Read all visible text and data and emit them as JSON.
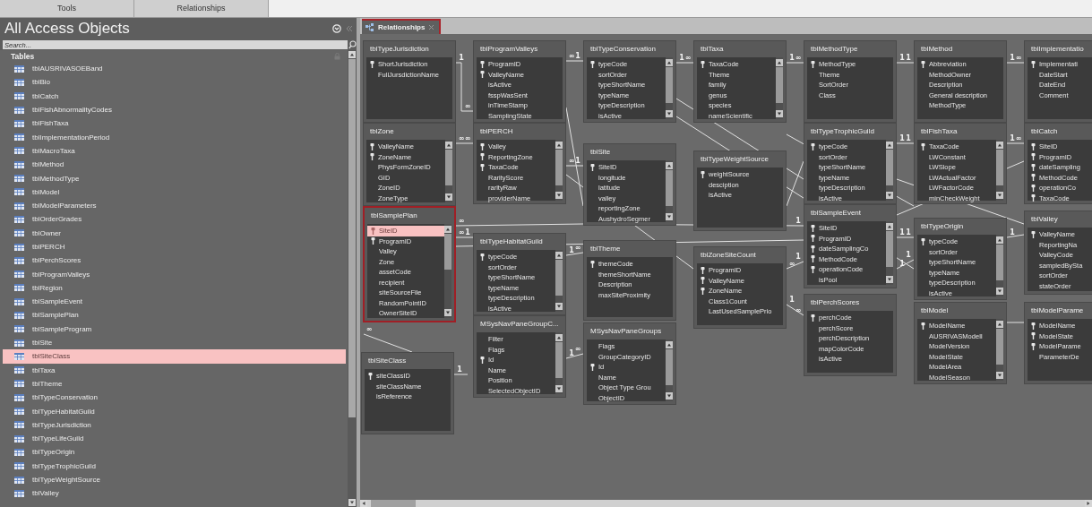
{
  "ribbon_groups": [
    "Tools",
    "Relationships"
  ],
  "navigation_pane": {
    "title": "All Access Objects",
    "search": {
      "placeholder": "Search..."
    },
    "group": "Tables",
    "items": [
      {
        "label": "tblAUSRIVASOEBand",
        "selected": false
      },
      {
        "label": "tblBio",
        "selected": false
      },
      {
        "label": "tblCatch",
        "selected": false
      },
      {
        "label": "tblFishAbnormalityCodes",
        "selected": false
      },
      {
        "label": "tblFishTaxa",
        "selected": false
      },
      {
        "label": "tblImplementationPeriod",
        "selected": false
      },
      {
        "label": "tblMacroTaxa",
        "selected": false
      },
      {
        "label": "tblMethod",
        "selected": false
      },
      {
        "label": "tblMethodType",
        "selected": false
      },
      {
        "label": "tblModel",
        "selected": false
      },
      {
        "label": "tblModelParameters",
        "selected": false
      },
      {
        "label": "tblOrderGrades",
        "selected": false
      },
      {
        "label": "tblOwner",
        "selected": false
      },
      {
        "label": "tblPERCH",
        "selected": false
      },
      {
        "label": "tblPerchScores",
        "selected": false
      },
      {
        "label": "tblProgramValleys",
        "selected": false
      },
      {
        "label": "tblRegion",
        "selected": false
      },
      {
        "label": "tblSampleEvent",
        "selected": false
      },
      {
        "label": "tblSamplePlan",
        "selected": false
      },
      {
        "label": "tblSampleProgram",
        "selected": false
      },
      {
        "label": "tblSite",
        "selected": false
      },
      {
        "label": "tblSiteClass",
        "selected": true
      },
      {
        "label": "tblTaxa",
        "selected": false
      },
      {
        "label": "tblTheme",
        "selected": false
      },
      {
        "label": "tblTypeConservation",
        "selected": false
      },
      {
        "label": "tblTypeHabitatGuild",
        "selected": false
      },
      {
        "label": "tblTypeJurisdiction",
        "selected": false
      },
      {
        "label": "tblTypeLifeGuild",
        "selected": false
      },
      {
        "label": "tblTypeOrigin",
        "selected": false
      },
      {
        "label": "tblTypeTrophicGuild",
        "selected": false
      },
      {
        "label": "tblTypeWeightSource",
        "selected": false
      },
      {
        "label": "tblValley",
        "selected": false
      }
    ]
  },
  "document_tab": {
    "label": "Relationships",
    "selected": true
  },
  "tables": [
    {
      "name": "tblTypeJurisdiction",
      "selected": false,
      "scrollbar": false,
      "fields": [
        {
          "name": "ShortJurisdiction",
          "key": true,
          "selected": false
        },
        {
          "name": "FullJursdictionName",
          "key": false,
          "selected": false
        }
      ]
    },
    {
      "name": "tblProgramValleys",
      "selected": false,
      "scrollbar": false,
      "fields": [
        {
          "name": "ProgramID",
          "key": true,
          "selected": false
        },
        {
          "name": "ValleyName",
          "key": true,
          "selected": false
        },
        {
          "name": "isActive",
          "key": false,
          "selected": false
        },
        {
          "name": "fsspWasSent",
          "key": false,
          "selected": false
        },
        {
          "name": "inTimeStamp",
          "key": false,
          "selected": false
        },
        {
          "name": "SamplingState",
          "key": false,
          "selected": false
        }
      ]
    },
    {
      "name": "tblTypeConservation",
      "selected": false,
      "scrollbar": true,
      "fields": [
        {
          "name": "typeCode",
          "key": true,
          "selected": false
        },
        {
          "name": "sortOrder",
          "key": false,
          "selected": false
        },
        {
          "name": "typeShortName",
          "key": false,
          "selected": false
        },
        {
          "name": "typeName",
          "key": false,
          "selected": false
        },
        {
          "name": "typeDescription",
          "key": false,
          "selected": false
        },
        {
          "name": "isActive",
          "key": false,
          "selected": false
        }
      ]
    },
    {
      "name": "tblTaxa",
      "selected": false,
      "scrollbar": true,
      "fields": [
        {
          "name": "TaxaCode",
          "key": true,
          "selected": false
        },
        {
          "name": "Theme",
          "key": false,
          "selected": false
        },
        {
          "name": "family",
          "key": false,
          "selected": false
        },
        {
          "name": "genus",
          "key": false,
          "selected": false
        },
        {
          "name": "species",
          "key": false,
          "selected": false
        },
        {
          "name": "nameScientific",
          "key": false,
          "selected": false
        }
      ]
    },
    {
      "name": "tblMethodType",
      "selected": false,
      "scrollbar": false,
      "fields": [
        {
          "name": "MethodType",
          "key": true,
          "selected": false
        },
        {
          "name": "Theme",
          "key": false,
          "selected": false
        },
        {
          "name": "SortOrder",
          "key": false,
          "selected": false
        },
        {
          "name": "Class",
          "key": false,
          "selected": false
        }
      ]
    },
    {
      "name": "tblMethod",
      "selected": false,
      "scrollbar": false,
      "fields": [
        {
          "name": "Abbreviation",
          "key": true,
          "selected": false
        },
        {
          "name": "MethodOwner",
          "key": false,
          "selected": false
        },
        {
          "name": "Description",
          "key": false,
          "selected": false
        },
        {
          "name": "General description",
          "key": false,
          "selected": false
        },
        {
          "name": "MethodType",
          "key": false,
          "selected": false
        }
      ]
    },
    {
      "name": "tblImplementatio",
      "selected": false,
      "scrollbar": false,
      "fields": [
        {
          "name": "Implementati",
          "key": true,
          "selected": false
        },
        {
          "name": "DateStart",
          "key": false,
          "selected": false
        },
        {
          "name": "DateEnd",
          "key": false,
          "selected": false
        },
        {
          "name": "Comment",
          "key": false,
          "selected": false
        }
      ]
    },
    {
      "name": "tblZone",
      "selected": false,
      "scrollbar": true,
      "fields": [
        {
          "name": "ValleyName",
          "key": true,
          "selected": false
        },
        {
          "name": "ZoneName",
          "key": true,
          "selected": false
        },
        {
          "name": "PhysFormZoneID",
          "key": false,
          "selected": false
        },
        {
          "name": "GID",
          "key": false,
          "selected": false
        },
        {
          "name": "ZoneID",
          "key": false,
          "selected": false
        },
        {
          "name": "ZoneType",
          "key": false,
          "selected": false
        }
      ]
    },
    {
      "name": "tblPERCH",
      "selected": false,
      "scrollbar": true,
      "fields": [
        {
          "name": "Valley",
          "key": true,
          "selected": false
        },
        {
          "name": "ReportingZone",
          "key": true,
          "selected": false
        },
        {
          "name": "TaxaCode",
          "key": true,
          "selected": false
        },
        {
          "name": "RarityScore",
          "key": false,
          "selected": false
        },
        {
          "name": "rarityRaw",
          "key": false,
          "selected": false
        },
        {
          "name": "providerName",
          "key": false,
          "selected": false
        }
      ]
    },
    {
      "name": "tblSite",
      "selected": false,
      "scrollbar": true,
      "fields": [
        {
          "name": "SiteID",
          "key": true,
          "selected": false
        },
        {
          "name": "longitude",
          "key": false,
          "selected": false
        },
        {
          "name": "latitude",
          "key": false,
          "selected": false
        },
        {
          "name": "valley",
          "key": false,
          "selected": false
        },
        {
          "name": "reportingZone",
          "key": false,
          "selected": false
        },
        {
          "name": "AushydroSegmer",
          "key": false,
          "selected": false
        }
      ]
    },
    {
      "name": "tblTypeWeightSource",
      "selected": false,
      "scrollbar": false,
      "fields": [
        {
          "name": "weightSource",
          "key": true,
          "selected": false
        },
        {
          "name": "desciption",
          "key": false,
          "selected": false
        },
        {
          "name": "isActive",
          "key": false,
          "selected": false
        }
      ]
    },
    {
      "name": "tblTypeTrophicGuild",
      "selected": false,
      "scrollbar": true,
      "fields": [
        {
          "name": "typeCode",
          "key": true,
          "selected": false
        },
        {
          "name": "sortOrder",
          "key": false,
          "selected": false
        },
        {
          "name": "typeShortName",
          "key": false,
          "selected": false
        },
        {
          "name": "typeName",
          "key": false,
          "selected": false
        },
        {
          "name": "typeDescription",
          "key": false,
          "selected": false
        },
        {
          "name": "isActive",
          "key": false,
          "selected": false
        }
      ]
    },
    {
      "name": "tblFishTaxa",
      "selected": false,
      "scrollbar": true,
      "fields": [
        {
          "name": "TaxaCode",
          "key": true,
          "selected": false
        },
        {
          "name": "LWConstant",
          "key": false,
          "selected": false
        },
        {
          "name": "LWSlope",
          "key": false,
          "selected": false
        },
        {
          "name": "LWActualFactor",
          "key": false,
          "selected": false
        },
        {
          "name": "LWFactorCode",
          "key": false,
          "selected": false
        },
        {
          "name": "minCheckWeight",
          "key": false,
          "selected": false
        }
      ]
    },
    {
      "name": "tblCatch",
      "selected": false,
      "scrollbar": false,
      "fields": [
        {
          "name": "SiteID",
          "key": true,
          "selected": false
        },
        {
          "name": "ProgramID",
          "key": true,
          "selected": false
        },
        {
          "name": "dateSampling",
          "key": true,
          "selected": false
        },
        {
          "name": "MethodCode",
          "key": true,
          "selected": false
        },
        {
          "name": "operationCo",
          "key": true,
          "selected": false
        },
        {
          "name": "TaxaCode",
          "key": true,
          "selected": false
        }
      ]
    },
    {
      "name": "tblSamplePlan",
      "selected": true,
      "scrollbar": true,
      "fields": [
        {
          "name": "SiteID",
          "key": true,
          "selected": true
        },
        {
          "name": "ProgramID",
          "key": true,
          "selected": false
        },
        {
          "name": "Valley",
          "key": false,
          "selected": false
        },
        {
          "name": "Zone",
          "key": false,
          "selected": false
        },
        {
          "name": "assetCode",
          "key": false,
          "selected": false
        },
        {
          "name": "recipient",
          "key": false,
          "selected": false
        },
        {
          "name": "siteSourceFile",
          "key": false,
          "selected": false
        },
        {
          "name": "RandomPointID",
          "key": false,
          "selected": false
        },
        {
          "name": "OwnerSiteID",
          "key": false,
          "selected": false
        }
      ]
    },
    {
      "name": "tblTypeHabitatGuild",
      "selected": false,
      "scrollbar": true,
      "fields": [
        {
          "name": "typeCode",
          "key": true,
          "selected": false
        },
        {
          "name": "sortOrder",
          "key": false,
          "selected": false
        },
        {
          "name": "typeShortName",
          "key": false,
          "selected": false
        },
        {
          "name": "typeName",
          "key": false,
          "selected": false
        },
        {
          "name": "typeDescription",
          "key": false,
          "selected": false
        },
        {
          "name": "isActive",
          "key": false,
          "selected": false
        }
      ]
    },
    {
      "name": "tblTheme",
      "selected": false,
      "scrollbar": false,
      "fields": [
        {
          "name": "themeCode",
          "key": true,
          "selected": false
        },
        {
          "name": "themeShortName",
          "key": false,
          "selected": false
        },
        {
          "name": "Description",
          "key": false,
          "selected": false
        },
        {
          "name": "maxSiteProximity",
          "key": false,
          "selected": false
        }
      ]
    },
    {
      "name": "tblZoneSiteCount",
      "selected": false,
      "scrollbar": false,
      "fields": [
        {
          "name": "ProgramID",
          "key": true,
          "selected": false
        },
        {
          "name": "ValleyName",
          "key": true,
          "selected": false
        },
        {
          "name": "ZoneName",
          "key": true,
          "selected": false
        },
        {
          "name": "Class1Count",
          "key": false,
          "selected": false
        },
        {
          "name": "LastUsedSamplePrio",
          "key": false,
          "selected": false
        }
      ]
    },
    {
      "name": "tblSampleEvent",
      "selected": false,
      "scrollbar": true,
      "fields": [
        {
          "name": "SiteID",
          "key": true,
          "selected": false
        },
        {
          "name": "ProgramID",
          "key": true,
          "selected": false
        },
        {
          "name": "dateSamplingCo",
          "key": true,
          "selected": false
        },
        {
          "name": "MethodCode",
          "key": true,
          "selected": false
        },
        {
          "name": "operationCode",
          "key": true,
          "selected": false
        },
        {
          "name": "isPool",
          "key": false,
          "selected": false
        }
      ]
    },
    {
      "name": "tblTypeOrigin",
      "selected": false,
      "scrollbar": true,
      "fields": [
        {
          "name": "typeCode",
          "key": true,
          "selected": false
        },
        {
          "name": "sortOrder",
          "key": false,
          "selected": false
        },
        {
          "name": "typeShortName",
          "key": false,
          "selected": false
        },
        {
          "name": "typeName",
          "key": false,
          "selected": false
        },
        {
          "name": "typeDescription",
          "key": false,
          "selected": false
        },
        {
          "name": "isActive",
          "key": false,
          "selected": false
        }
      ]
    },
    {
      "name": "tblValley",
      "selected": false,
      "scrollbar": false,
      "fields": [
        {
          "name": "ValleyName",
          "key": true,
          "selected": false
        },
        {
          "name": "ReportingNa",
          "key": false,
          "selected": false
        },
        {
          "name": "ValleyCode",
          "key": false,
          "selected": false
        },
        {
          "name": "sampledBySta",
          "key": false,
          "selected": false
        },
        {
          "name": "sortOrder",
          "key": false,
          "selected": false
        },
        {
          "name": "stateOrder",
          "key": false,
          "selected": false
        }
      ]
    },
    {
      "name": "tblPerchScores",
      "selected": false,
      "scrollbar": false,
      "fields": [
        {
          "name": "perchCode",
          "key": true,
          "selected": false
        },
        {
          "name": "perchScore",
          "key": false,
          "selected": false
        },
        {
          "name": "perchDescription",
          "key": false,
          "selected": false
        },
        {
          "name": "mapColorCode",
          "key": false,
          "selected": false
        },
        {
          "name": "isActive",
          "key": false,
          "selected": false
        }
      ]
    },
    {
      "name": "tblModel",
      "selected": false,
      "scrollbar": true,
      "fields": [
        {
          "name": "ModelName",
          "key": true,
          "selected": false
        },
        {
          "name": "AUSRIVASModelI",
          "key": false,
          "selected": false
        },
        {
          "name": "ModelVersion",
          "key": false,
          "selected": false
        },
        {
          "name": "ModelState",
          "key": false,
          "selected": false
        },
        {
          "name": "ModelArea",
          "key": false,
          "selected": false
        },
        {
          "name": "ModelSeason",
          "key": false,
          "selected": false
        }
      ]
    },
    {
      "name": "tblModelParame",
      "selected": false,
      "scrollbar": false,
      "fields": [
        {
          "name": "ModelName",
          "key": true,
          "selected": false
        },
        {
          "name": "ModelState",
          "key": true,
          "selected": false
        },
        {
          "name": "ModelParame",
          "key": true,
          "selected": false
        },
        {
          "name": "ParameterDe",
          "key": false,
          "selected": false
        }
      ]
    },
    {
      "name": "MSysNavPaneGroupC...",
      "selected": false,
      "scrollbar": true,
      "fields": [
        {
          "name": "Filter",
          "key": false,
          "selected": false
        },
        {
          "name": "Flags",
          "key": false,
          "selected": false
        },
        {
          "name": "Id",
          "key": true,
          "selected": false
        },
        {
          "name": "Name",
          "key": false,
          "selected": false
        },
        {
          "name": "Position",
          "key": false,
          "selected": false
        },
        {
          "name": "SelectedObjectID",
          "key": false,
          "selected": false
        }
      ]
    },
    {
      "name": "MSysNavPaneGroups",
      "selected": false,
      "scrollbar": true,
      "fields": [
        {
          "name": "Flags",
          "key": false,
          "selected": false
        },
        {
          "name": "GroupCategoryID",
          "key": false,
          "selected": false
        },
        {
          "name": "Id",
          "key": true,
          "selected": false
        },
        {
          "name": "Name",
          "key": false,
          "selected": false
        },
        {
          "name": "Object Type Grou",
          "key": false,
          "selected": false
        },
        {
          "name": "ObjectID",
          "key": false,
          "selected": false
        }
      ]
    },
    {
      "name": "tblSiteClass",
      "selected": false,
      "scrollbar": false,
      "fields": [
        {
          "name": "siteClassID",
          "key": true,
          "selected": false
        },
        {
          "name": "siteClassName",
          "key": false,
          "selected": false
        },
        {
          "name": "isReference",
          "key": false,
          "selected": false
        }
      ]
    }
  ],
  "relationships": [
    {
      "ends": [
        "1",
        "∞"
      ]
    },
    {
      "ends": [
        "∞",
        "1"
      ]
    },
    {
      "ends": [
        "1",
        "∞"
      ]
    },
    {
      "ends": [
        "1",
        "∞"
      ]
    },
    {
      "ends": [
        "1",
        "1"
      ]
    },
    {
      "ends": [
        "1",
        "∞"
      ]
    },
    {
      "ends": [
        "∞",
        "∞"
      ]
    },
    {
      "ends": [
        "∞",
        "1"
      ]
    },
    {
      "ends": [
        "∞",
        "1"
      ]
    },
    {
      "ends": [
        "∞",
        "1"
      ]
    },
    {
      "ends": [
        "1",
        "∞"
      ]
    },
    {
      "ends": [
        "∞",
        "1"
      ]
    },
    {
      "ends": [
        "1",
        "∞"
      ]
    },
    {
      "ends": [
        "1",
        "∞"
      ]
    },
    {
      "ends": [
        "∞"
      ]
    },
    {
      "ends": [
        "1"
      ]
    },
    {
      "ends": [
        "1",
        "1"
      ]
    },
    {
      "ends": [
        "1",
        "∞"
      ]
    },
    {
      "ends": [
        "1",
        "1"
      ]
    },
    {
      "ends": [
        "1"
      ]
    },
    {
      "ends": [
        "1",
        "1"
      ]
    }
  ]
}
